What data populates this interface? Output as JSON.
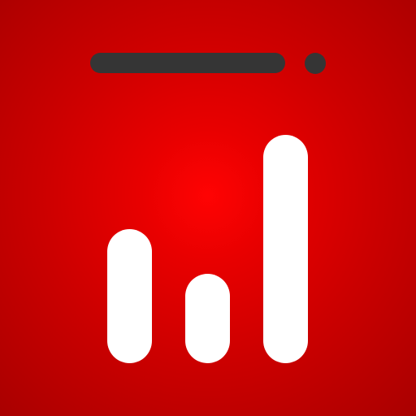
{
  "icon": {
    "name": "bar-chart-app-icon",
    "background_color": "#e00000",
    "glyph_color": "#ffffff",
    "accent_color": "#353535"
  },
  "bars": {
    "levels": [
      0.59,
      0.39,
      1.0
    ]
  }
}
